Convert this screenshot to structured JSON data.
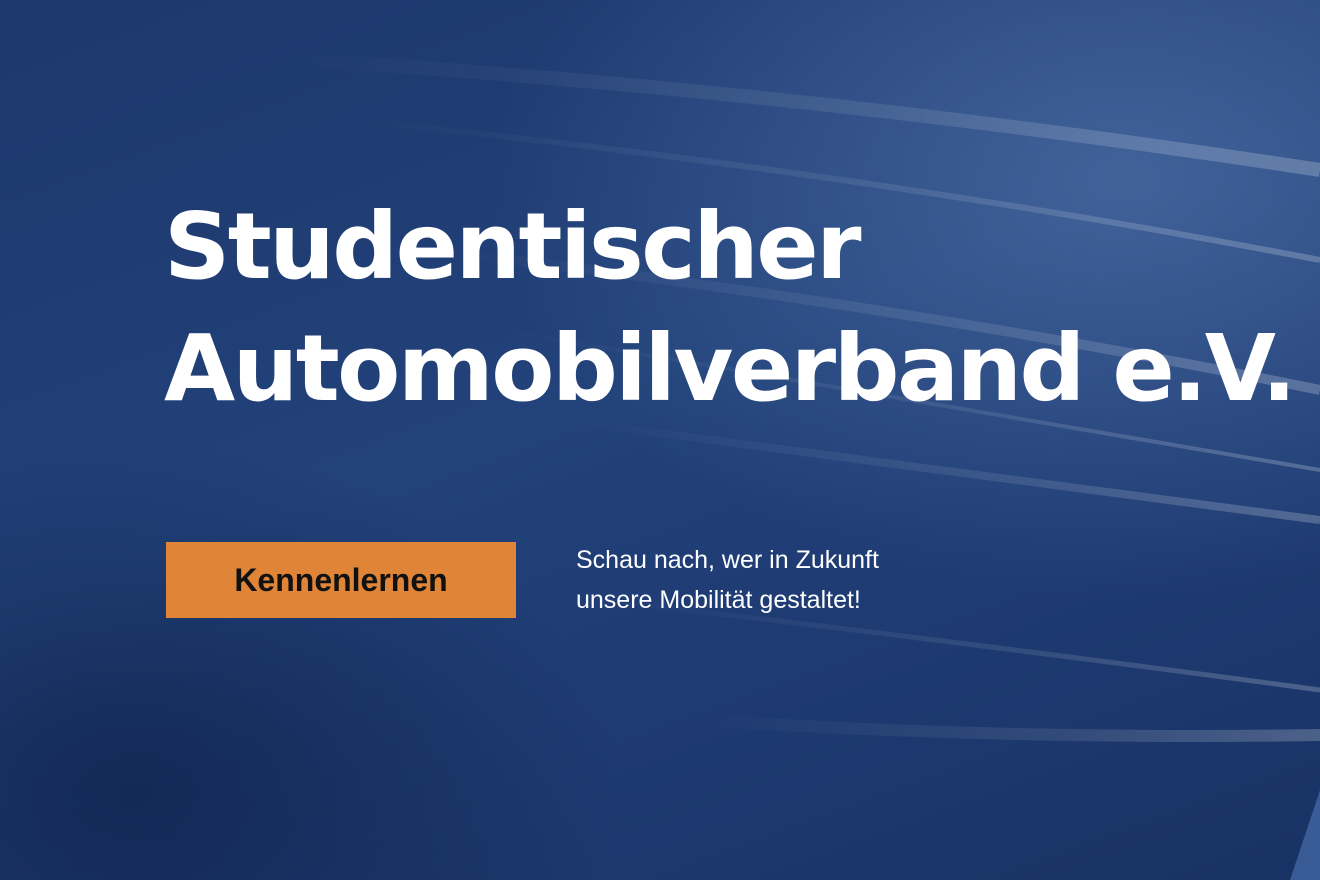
{
  "hero": {
    "title_line1": "Studentischer",
    "title_line2": "Automobilverband e.V.",
    "cta_label": "Kennenlernen",
    "tagline_line1": "Schau nach, wer in Zukunft",
    "tagline_line2": "unsere Mobilität gestaltet!"
  },
  "colors": {
    "background": "#1f3a6e",
    "accent": "#e08438",
    "text": "#ffffff",
    "button_text": "#111111"
  }
}
